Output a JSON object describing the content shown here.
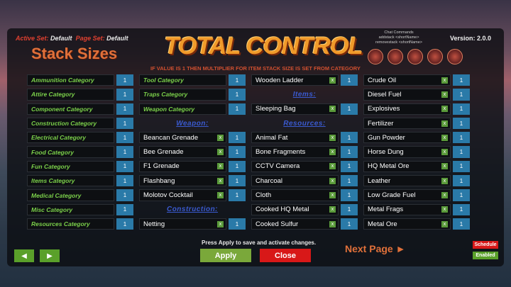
{
  "header": {
    "active_set_label": "Active Set:",
    "active_set_value": "Default",
    "page_set_label": "Page Set:",
    "page_set_value": "Default",
    "page_title": "Stack Sizes",
    "logo_text": "TOTAL CONTROL",
    "note": "IF VALUE IS 1 THEN MULTIPLIER FOR ITEM STACK SIZE IS SET FROM CATEGORY",
    "chat_commands": "Chat Commands\naddstack <shortName>\nremovestack <shortName>",
    "version": "Version: 2.0.0"
  },
  "columns": [
    [
      {
        "type": "cat",
        "label": "Ammunition Category",
        "value": "1"
      },
      {
        "type": "cat",
        "label": "Attire Category",
        "value": "1"
      },
      {
        "type": "cat",
        "label": "Component Category",
        "value": "1"
      },
      {
        "type": "cat",
        "label": "Construction Category",
        "value": "1"
      },
      {
        "type": "cat",
        "label": "Electrical Category",
        "value": "1"
      },
      {
        "type": "cat",
        "label": "Food Category",
        "value": "1"
      },
      {
        "type": "cat",
        "label": "Fun Category",
        "value": "1"
      },
      {
        "type": "cat",
        "label": "Items Category",
        "value": "1"
      },
      {
        "type": "cat",
        "label": "Medical Category",
        "value": "1"
      },
      {
        "type": "cat",
        "label": "Misc Category",
        "value": "1"
      },
      {
        "type": "cat",
        "label": "Resources Category",
        "value": "1"
      }
    ],
    [
      {
        "type": "cat",
        "label": "Tool Category",
        "value": "1"
      },
      {
        "type": "cat",
        "label": "Traps Category",
        "value": "1"
      },
      {
        "type": "cat",
        "label": "Weapon Category",
        "value": "1"
      },
      {
        "type": "hdr",
        "label": "Weapon:"
      },
      {
        "type": "item",
        "label": "Beancan Grenade",
        "value": "1"
      },
      {
        "type": "item",
        "label": "Bee Grenade",
        "value": "1"
      },
      {
        "type": "item",
        "label": "F1 Grenade",
        "value": "1"
      },
      {
        "type": "item",
        "label": "Flashbang",
        "value": "1"
      },
      {
        "type": "item",
        "label": "Molotov Cocktail",
        "value": "1"
      },
      {
        "type": "hdr",
        "label": "Construction:"
      },
      {
        "type": "item",
        "label": "Netting",
        "value": "1"
      }
    ],
    [
      {
        "type": "item",
        "label": "Wooden Ladder",
        "value": "1"
      },
      {
        "type": "hdr",
        "label": "Items:"
      },
      {
        "type": "item",
        "label": "Sleeping Bag",
        "value": "1"
      },
      {
        "type": "hdr",
        "label": "Resources:"
      },
      {
        "type": "item",
        "label": "Animal Fat",
        "value": "1"
      },
      {
        "type": "item",
        "label": "Bone Fragments",
        "value": "1"
      },
      {
        "type": "item",
        "label": "CCTV Camera",
        "value": "1"
      },
      {
        "type": "item",
        "label": "Charcoal",
        "value": "1"
      },
      {
        "type": "item",
        "label": "Cloth",
        "value": "1"
      },
      {
        "type": "item",
        "label": "Cooked HQ Metal",
        "value": "1"
      },
      {
        "type": "item",
        "label": "Cooked Sulfur",
        "value": "1"
      }
    ],
    [
      {
        "type": "item",
        "label": "Crude Oil",
        "value": "1"
      },
      {
        "type": "item",
        "label": "Diesel Fuel",
        "value": "1"
      },
      {
        "type": "item",
        "label": "Explosives",
        "value": "1"
      },
      {
        "type": "item",
        "label": "Fertilizer",
        "value": "1"
      },
      {
        "type": "item",
        "label": "Gun Powder",
        "value": "1"
      },
      {
        "type": "item",
        "label": "Horse Dung",
        "value": "1"
      },
      {
        "type": "item",
        "label": "HQ Metal Ore",
        "value": "1"
      },
      {
        "type": "item",
        "label": "Leather",
        "value": "1"
      },
      {
        "type": "item",
        "label": "Low Grade Fuel",
        "value": "1"
      },
      {
        "type": "item",
        "label": "Metal Frags",
        "value": "1"
      },
      {
        "type": "item",
        "label": "Metal Ore",
        "value": "1"
      }
    ]
  ],
  "remove_glyph": "x",
  "footer": {
    "prev_label": "◀",
    "next_label": "▶",
    "apply_note": "Press Apply to save and activate changes.",
    "apply_label": "Apply",
    "close_label": "Close",
    "next_page_label": "Next Page ►",
    "schedule_label": "Schedule",
    "enabled_label": "Enabled"
  }
}
